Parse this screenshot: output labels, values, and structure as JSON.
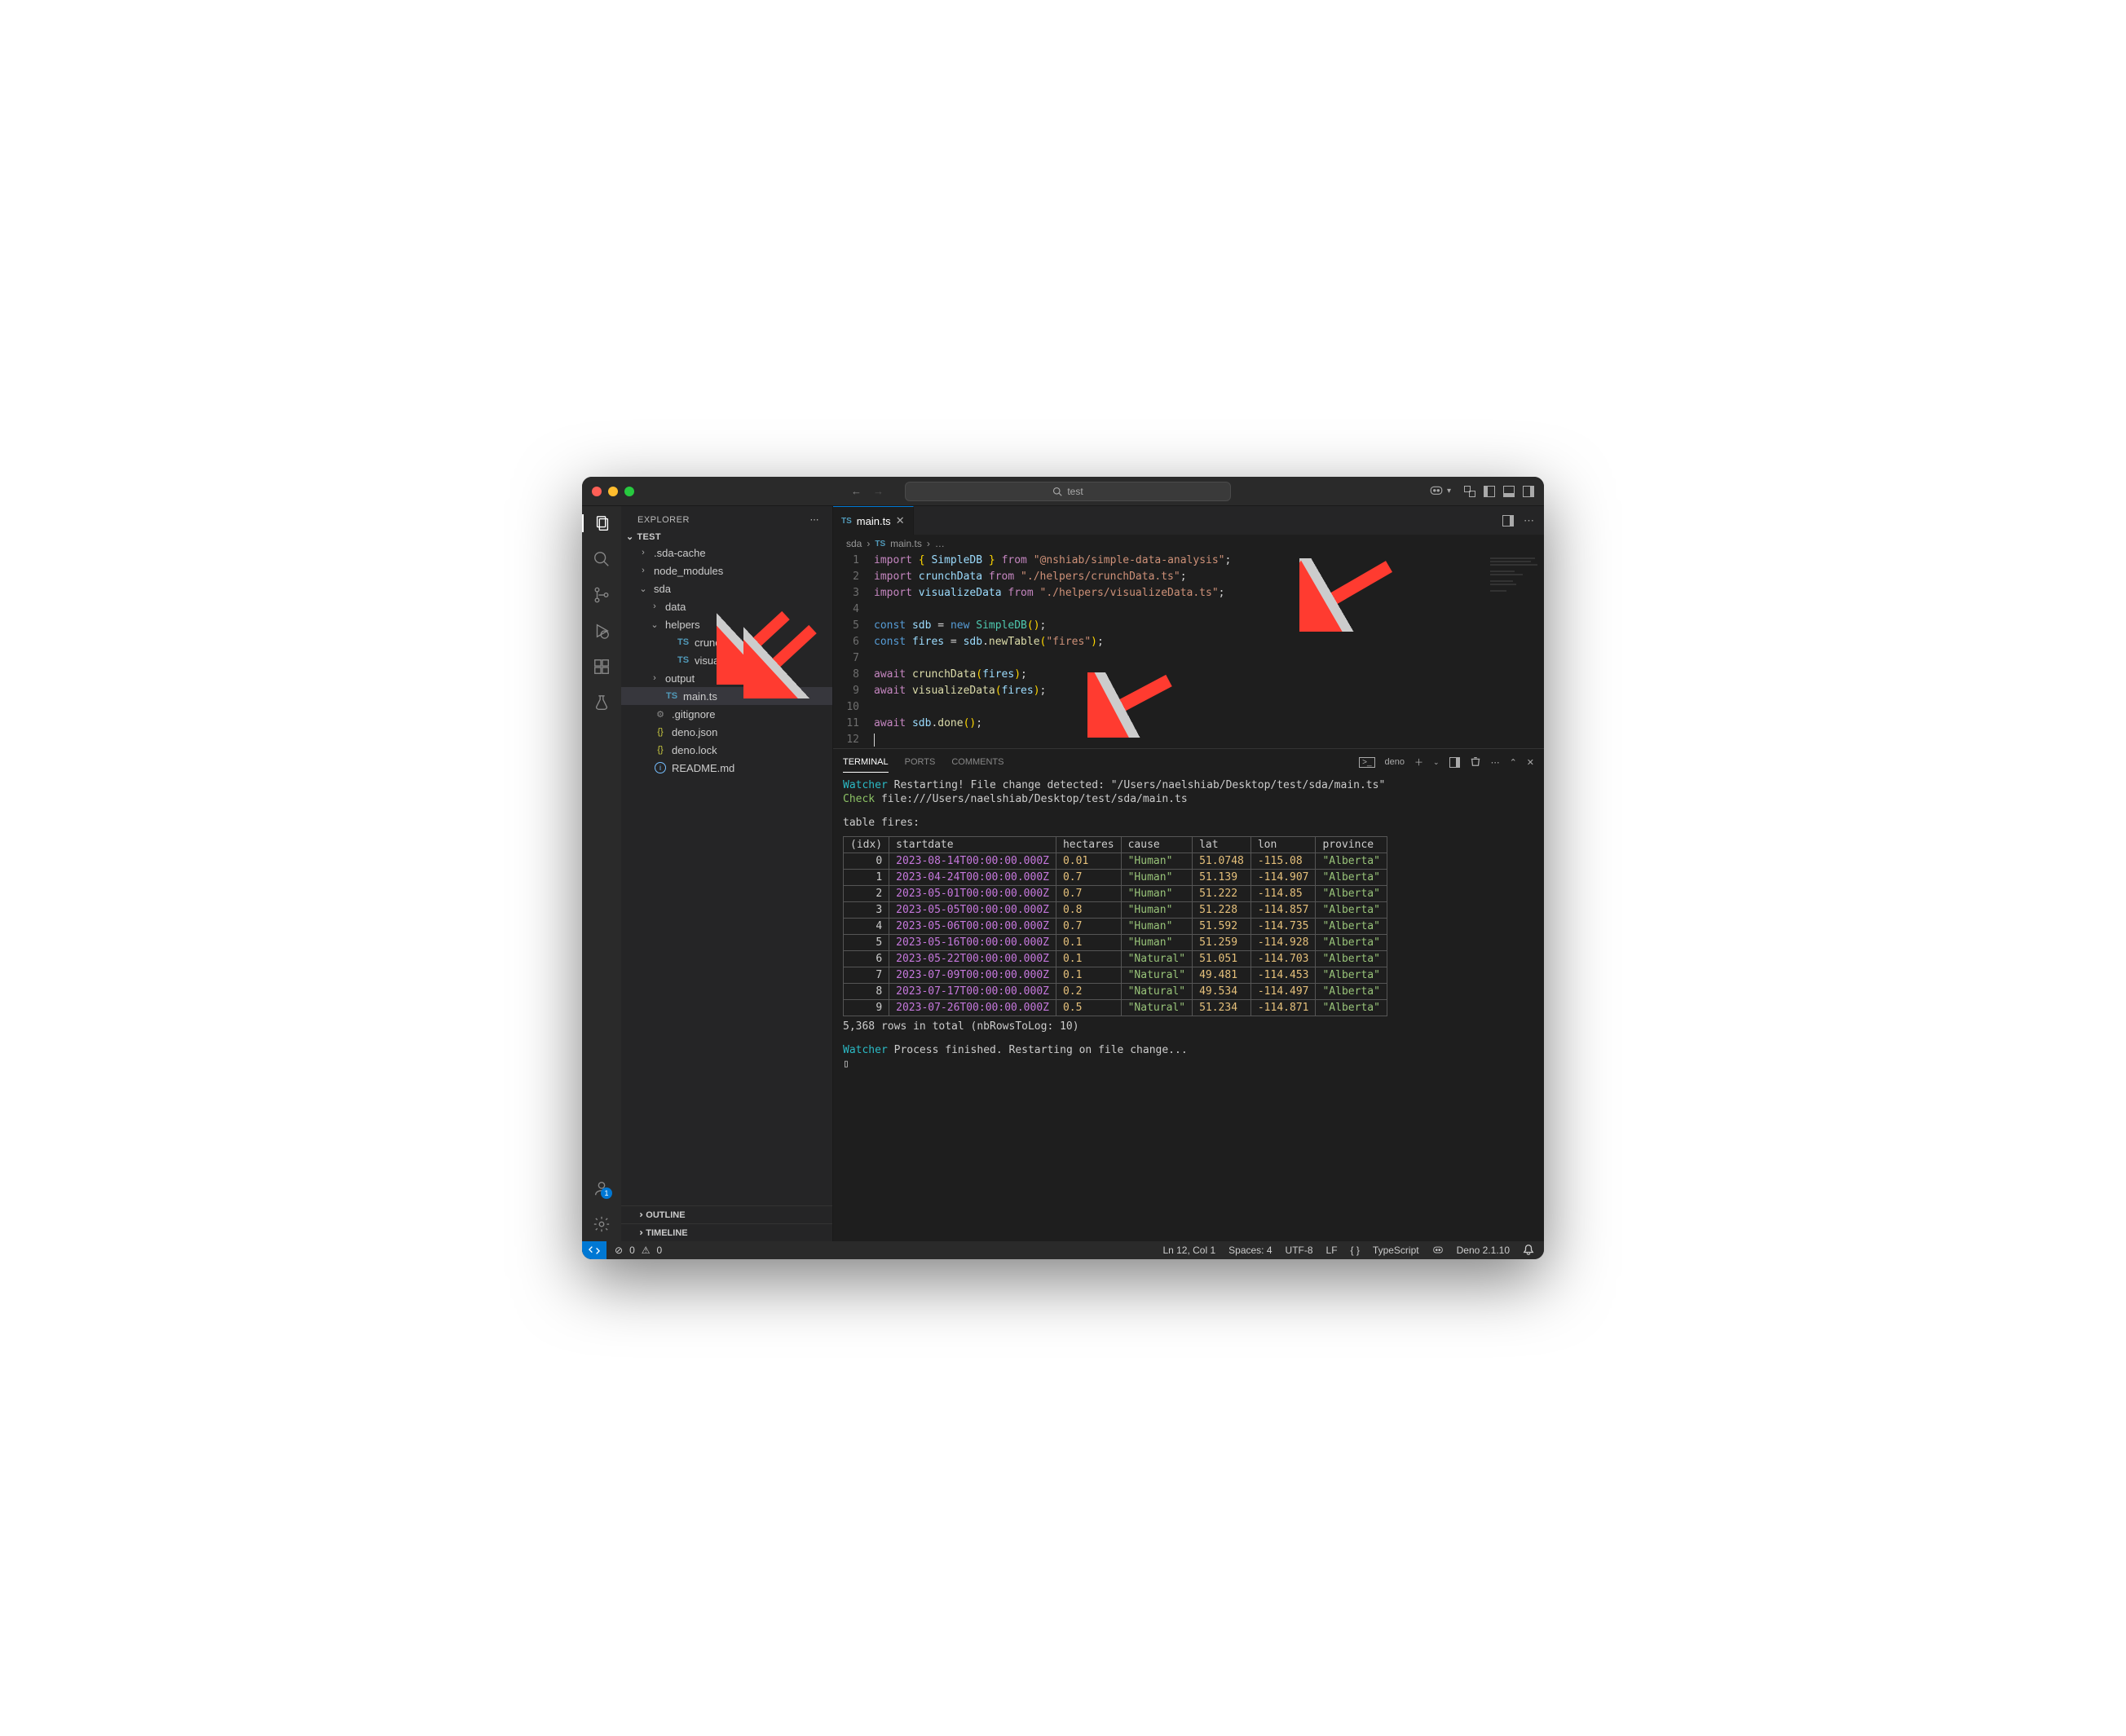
{
  "titlebar": {
    "search_text": "test"
  },
  "sidebar": {
    "header": "EXPLORER",
    "root": "TEST",
    "items": [
      {
        "label": ".sda-cache",
        "kind": "folder",
        "open": false,
        "depth": 1
      },
      {
        "label": "node_modules",
        "kind": "folder",
        "open": false,
        "depth": 1
      },
      {
        "label": "sda",
        "kind": "folder",
        "open": true,
        "depth": 1
      },
      {
        "label": "data",
        "kind": "folder",
        "open": false,
        "depth": 2
      },
      {
        "label": "helpers",
        "kind": "folder",
        "open": true,
        "depth": 2
      },
      {
        "label": "crunchData.ts",
        "kind": "ts",
        "depth": 3
      },
      {
        "label": "visualizeData.ts",
        "kind": "ts",
        "depth": 3
      },
      {
        "label": "output",
        "kind": "folder",
        "open": false,
        "depth": 2
      },
      {
        "label": "main.ts",
        "kind": "ts",
        "depth": 2,
        "selected": true
      },
      {
        "label": ".gitignore",
        "kind": "gear",
        "depth": 1
      },
      {
        "label": "deno.json",
        "kind": "json",
        "depth": 1
      },
      {
        "label": "deno.lock",
        "kind": "json",
        "depth": 1
      },
      {
        "label": "README.md",
        "kind": "info",
        "depth": 1
      }
    ],
    "outline": "OUTLINE",
    "timeline": "TIMELINE"
  },
  "tabs": {
    "active_file": "main.ts"
  },
  "breadcrumb": {
    "root": "sda",
    "file": "main.ts",
    "more": "…"
  },
  "code": {
    "lines": [
      [
        {
          "c": "tk-kw",
          "t": "import"
        },
        {
          "t": " "
        },
        {
          "c": "tk-br",
          "t": "{"
        },
        {
          "t": " "
        },
        {
          "c": "tk-var",
          "t": "SimpleDB"
        },
        {
          "t": " "
        },
        {
          "c": "tk-br",
          "t": "}"
        },
        {
          "t": " "
        },
        {
          "c": "tk-kw",
          "t": "from"
        },
        {
          "t": " "
        },
        {
          "c": "tk-str",
          "t": "\"@nshiab/simple-data-analysis\""
        },
        {
          "t": ";"
        }
      ],
      [
        {
          "c": "tk-kw",
          "t": "import"
        },
        {
          "t": " "
        },
        {
          "c": "tk-var",
          "t": "crunchData"
        },
        {
          "t": " "
        },
        {
          "c": "tk-kw",
          "t": "from"
        },
        {
          "t": " "
        },
        {
          "c": "tk-str",
          "t": "\"./helpers/crunchData.ts\""
        },
        {
          "t": ";"
        }
      ],
      [
        {
          "c": "tk-kw",
          "t": "import"
        },
        {
          "t": " "
        },
        {
          "c": "tk-var",
          "t": "visualizeData"
        },
        {
          "t": " "
        },
        {
          "c": "tk-kw",
          "t": "from"
        },
        {
          "t": " "
        },
        {
          "c": "tk-str",
          "t": "\"./helpers/visualizeData.ts\""
        },
        {
          "t": ";"
        }
      ],
      [],
      [
        {
          "c": "tk-const",
          "t": "const"
        },
        {
          "t": " "
        },
        {
          "c": "tk-var",
          "t": "sdb"
        },
        {
          "t": " = "
        },
        {
          "c": "tk-const",
          "t": "new"
        },
        {
          "t": " "
        },
        {
          "c": "tk-type",
          "t": "SimpleDB"
        },
        {
          "c": "tk-br",
          "t": "()"
        },
        {
          "t": ";"
        }
      ],
      [
        {
          "c": "tk-const",
          "t": "const"
        },
        {
          "t": " "
        },
        {
          "c": "tk-var",
          "t": "fires"
        },
        {
          "t": " = "
        },
        {
          "c": "tk-var",
          "t": "sdb"
        },
        {
          "t": "."
        },
        {
          "c": "tk-fn",
          "t": "newTable"
        },
        {
          "c": "tk-br",
          "t": "("
        },
        {
          "c": "tk-str",
          "t": "\"fires\""
        },
        {
          "c": "tk-br",
          "t": ")"
        },
        {
          "t": ";"
        }
      ],
      [],
      [
        {
          "c": "tk-kw",
          "t": "await"
        },
        {
          "t": " "
        },
        {
          "c": "tk-fn",
          "t": "crunchData"
        },
        {
          "c": "tk-br",
          "t": "("
        },
        {
          "c": "tk-var",
          "t": "fires"
        },
        {
          "c": "tk-br",
          "t": ")"
        },
        {
          "t": ";"
        }
      ],
      [
        {
          "c": "tk-kw",
          "t": "await"
        },
        {
          "t": " "
        },
        {
          "c": "tk-fn",
          "t": "visualizeData"
        },
        {
          "c": "tk-br",
          "t": "("
        },
        {
          "c": "tk-var",
          "t": "fires"
        },
        {
          "c": "tk-br",
          "t": ")"
        },
        {
          "t": ";"
        }
      ],
      [],
      [
        {
          "c": "tk-kw",
          "t": "await"
        },
        {
          "t": " "
        },
        {
          "c": "tk-var",
          "t": "sdb"
        },
        {
          "t": "."
        },
        {
          "c": "tk-fn",
          "t": "done"
        },
        {
          "c": "tk-br",
          "t": "()"
        },
        {
          "t": ";"
        }
      ],
      []
    ]
  },
  "panel": {
    "tabs": {
      "terminal": "TERMINAL",
      "ports": "PORTS",
      "comments": "COMMENTS"
    },
    "task_label": "deno"
  },
  "terminal": {
    "line1_pre": "Watcher",
    "line1_rest": " Restarting! File change detected: \"/Users/naelshiab/Desktop/test/sda/main.ts\"",
    "line2_pre": "Check",
    "line2_rest": " file:///Users/naelshiab/Desktop/test/sda/main.ts",
    "table_intro": "table fires:",
    "headers": [
      "(idx)",
      "startdate",
      "hectares",
      "cause",
      "lat",
      "lon",
      "province"
    ],
    "rows": [
      [
        "0",
        "2023-08-14T00:00:00.000Z",
        "0.01",
        "\"Human\"",
        "51.0748",
        "-115.08",
        "\"Alberta\""
      ],
      [
        "1",
        "2023-04-24T00:00:00.000Z",
        "0.7",
        "\"Human\"",
        "51.139",
        "-114.907",
        "\"Alberta\""
      ],
      [
        "2",
        "2023-05-01T00:00:00.000Z",
        "0.7",
        "\"Human\"",
        "51.222",
        "-114.85",
        "\"Alberta\""
      ],
      [
        "3",
        "2023-05-05T00:00:00.000Z",
        "0.8",
        "\"Human\"",
        "51.228",
        "-114.857",
        "\"Alberta\""
      ],
      [
        "4",
        "2023-05-06T00:00:00.000Z",
        "0.7",
        "\"Human\"",
        "51.592",
        "-114.735",
        "\"Alberta\""
      ],
      [
        "5",
        "2023-05-16T00:00:00.000Z",
        "0.1",
        "\"Human\"",
        "51.259",
        "-114.928",
        "\"Alberta\""
      ],
      [
        "6",
        "2023-05-22T00:00:00.000Z",
        "0.1",
        "\"Natural\"",
        "51.051",
        "-114.703",
        "\"Alberta\""
      ],
      [
        "7",
        "2023-07-09T00:00:00.000Z",
        "0.1",
        "\"Natural\"",
        "49.481",
        "-114.453",
        "\"Alberta\""
      ],
      [
        "8",
        "2023-07-17T00:00:00.000Z",
        "0.2",
        "\"Natural\"",
        "49.534",
        "-114.497",
        "\"Alberta\""
      ],
      [
        "9",
        "2023-07-26T00:00:00.000Z",
        "0.5",
        "\"Natural\"",
        "51.234",
        "-114.871",
        "\"Alberta\""
      ]
    ],
    "summary": "5,368 rows in total (nbRowsToLog: 10)",
    "watcher2_pre": "Watcher",
    "watcher2_rest": " Process finished. Restarting on file change...",
    "cursor": "▯"
  },
  "statusbar": {
    "errors": "0",
    "warnings": "0",
    "cursor": "Ln 12, Col 1",
    "spaces": "Spaces: 4",
    "encoding": "UTF-8",
    "eol": "LF",
    "lang": "TypeScript",
    "runtime": "Deno 2.1.10"
  }
}
